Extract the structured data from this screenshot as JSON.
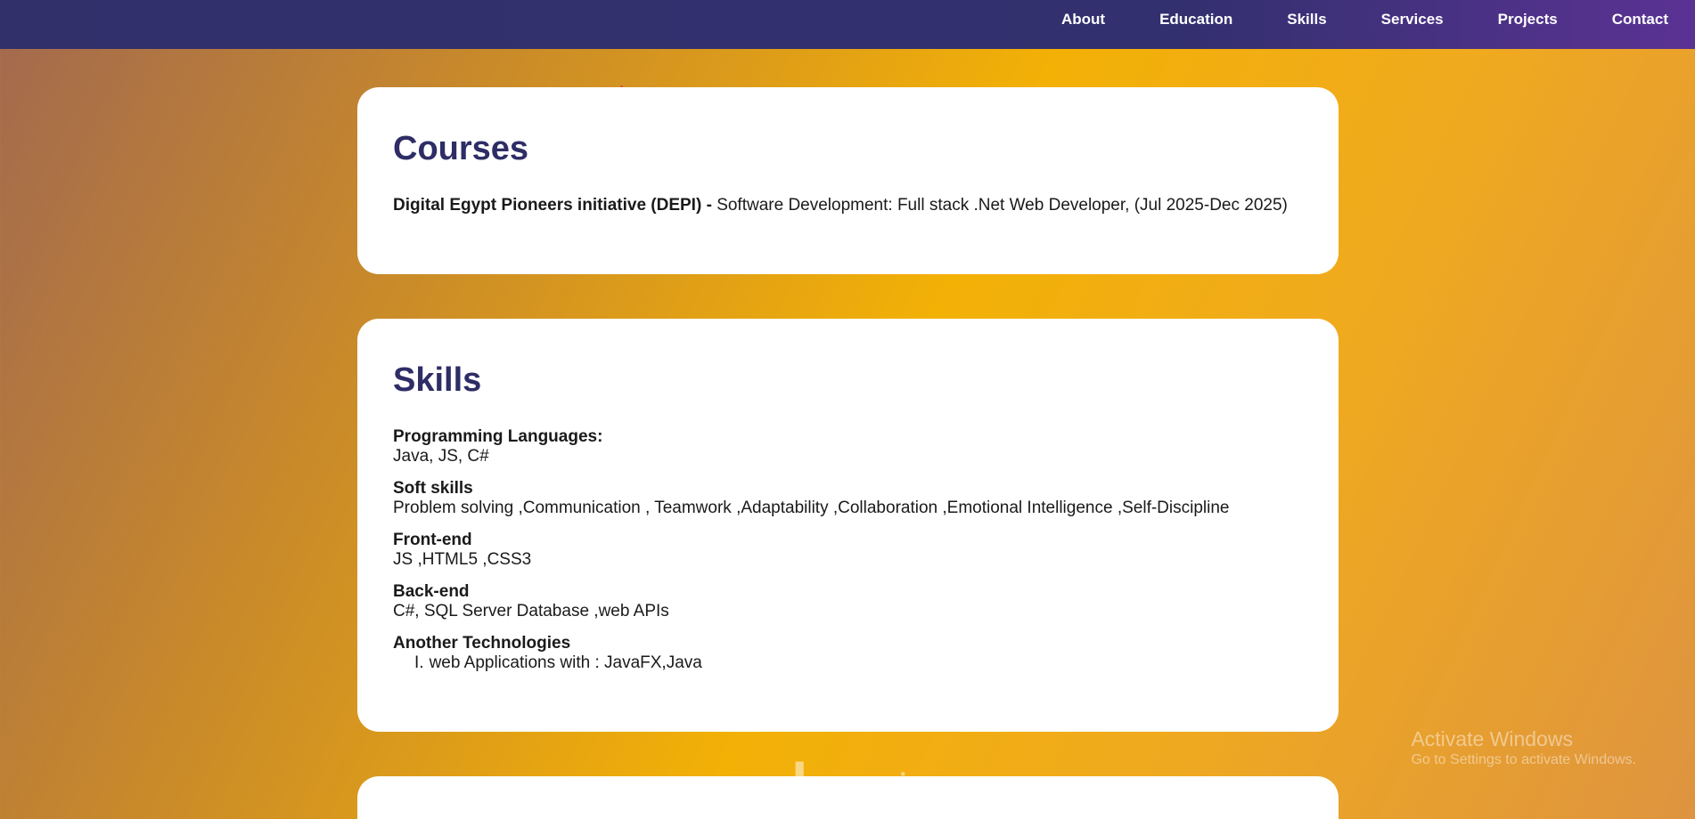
{
  "nav": {
    "items": [
      {
        "label": "About"
      },
      {
        "label": "Education"
      },
      {
        "label": "Skills"
      },
      {
        "label": "Services"
      },
      {
        "label": "Projects"
      },
      {
        "label": "Contact"
      }
    ]
  },
  "courses": {
    "title": "Courses",
    "org": "Digital Egypt Pioneers initiative (DEPI)",
    "separator": " - ",
    "details": "Software Development: Full stack .Net Web Developer, (Jul 2025-Dec 2025)"
  },
  "skills": {
    "title": "Skills",
    "groups": [
      {
        "heading": "Programming Languages:",
        "value": "Java, JS, C#"
      },
      {
        "heading": "Soft skills",
        "value": "Problem solving ,Communication , Teamwork ,Adaptability ,Collaboration ,Emotional Intelligence ,Self-Discipline"
      },
      {
        "heading": "Front-end",
        "value": "JS ,HTML5 ,CSS3"
      },
      {
        "heading": "Back-end",
        "value": "C#, SQL Server Database ,web APIs"
      },
      {
        "heading": "Another Technologies",
        "list": [
          {
            "marker": "I.",
            "text": "web Applications with : JavaFX,Java"
          }
        ]
      }
    ]
  },
  "watermarks": {
    "activate_title": "Activate Windows",
    "activate_sub": "Go to Settings to activate Windows.",
    "logo_text": "خمسات"
  },
  "colors": {
    "nav_bg": "#31306b",
    "heading": "#2e2d66",
    "card_bg": "#ffffff"
  }
}
